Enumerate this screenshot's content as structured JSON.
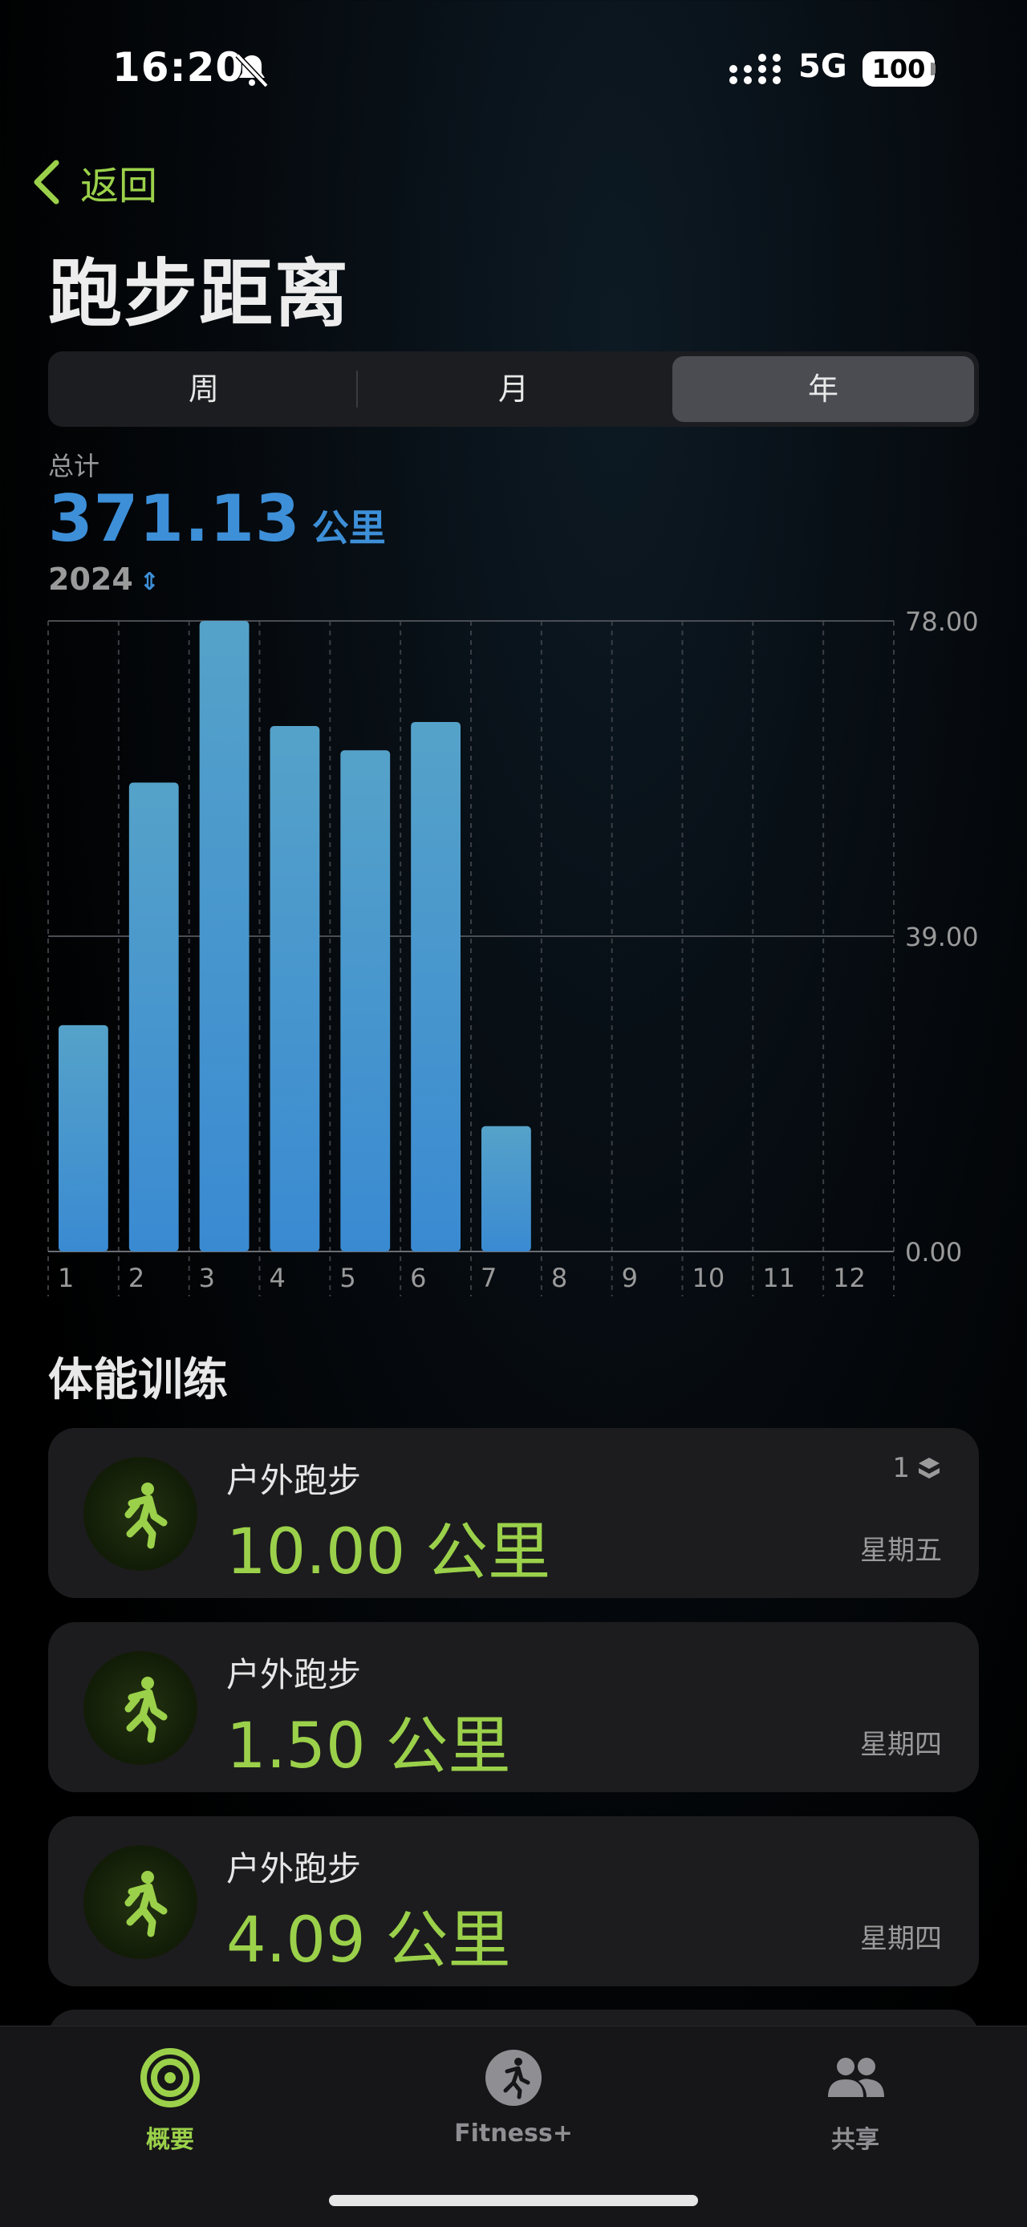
{
  "status_bar": {
    "time": "16:20",
    "network": "5G",
    "battery": "100"
  },
  "nav": {
    "back_label": "返回"
  },
  "title": "跑步距离",
  "segments": [
    {
      "label": "周",
      "active": false
    },
    {
      "label": "月",
      "active": false
    },
    {
      "label": "年",
      "active": true
    }
  ],
  "summary": {
    "label": "总计",
    "value": "371.13",
    "unit": "公里",
    "year": "2024"
  },
  "chart_data": {
    "type": "bar",
    "categories": [
      "1",
      "2",
      "3",
      "4",
      "5",
      "6",
      "7",
      "8",
      "9",
      "10",
      "11",
      "12"
    ],
    "values": [
      28,
      58,
      78,
      65,
      62,
      65.5,
      15.5,
      0,
      0,
      0,
      0,
      0
    ],
    "y_ticks": [
      "78.00",
      "39.00",
      "0.00"
    ],
    "ylim": [
      0,
      78
    ],
    "bar_color": "#3d8fd8",
    "grid": true
  },
  "workouts_title": "体能训练",
  "workouts": [
    {
      "type": "户外跑步",
      "distance": "10.00 公里",
      "day": "星期五",
      "badge": "1"
    },
    {
      "type": "户外跑步",
      "distance": "1.50 公里",
      "day": "星期四",
      "badge": ""
    },
    {
      "type": "户外跑步",
      "distance": "4.09 公里",
      "day": "星期四",
      "badge": ""
    }
  ],
  "tabs": [
    {
      "label": "概要",
      "icon": "activity-rings-icon",
      "active": true
    },
    {
      "label": "Fitness+",
      "icon": "fitness-plus-icon",
      "active": false
    },
    {
      "label": "共享",
      "icon": "sharing-icon",
      "active": false
    }
  ],
  "colors": {
    "accent_green": "#9bd14a",
    "accent_blue": "#3d8fd8"
  }
}
